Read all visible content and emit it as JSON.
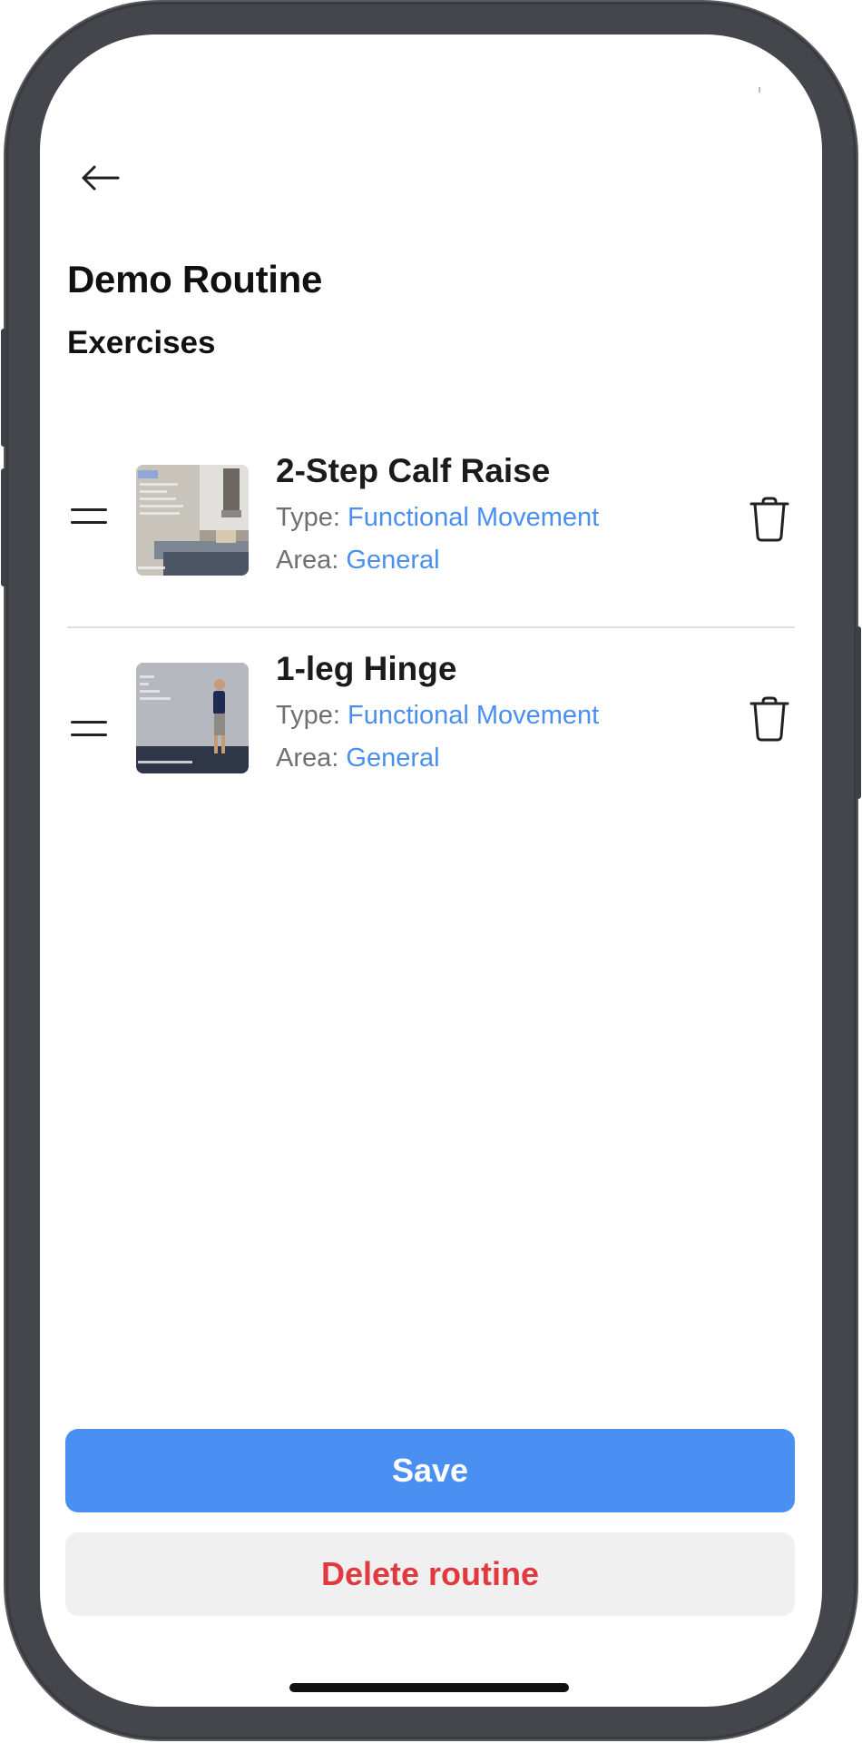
{
  "screen": {
    "title": "Demo Routine",
    "section_title": "Exercises"
  },
  "exercises": [
    {
      "name": "2-Step Calf Raise",
      "type_label": "Type:",
      "type_value": "Functional Movement",
      "area_label": "Area:",
      "area_value": "General"
    },
    {
      "name": "1-leg Hinge",
      "type_label": "Type:",
      "type_value": "Functional Movement",
      "area_label": "Area:",
      "area_value": "General"
    }
  ],
  "actions": {
    "save_label": "Save",
    "delete_label": "Delete routine"
  },
  "icons": {
    "back": "arrow-left-icon",
    "drag": "drag-handle-icon",
    "delete": "trash-icon"
  },
  "colors": {
    "accent": "#4a8ff2",
    "link": "#4a8ff0",
    "danger": "#e0393e",
    "secondary_button_bg": "#f0f0f0",
    "device_frame": "#45464b"
  }
}
